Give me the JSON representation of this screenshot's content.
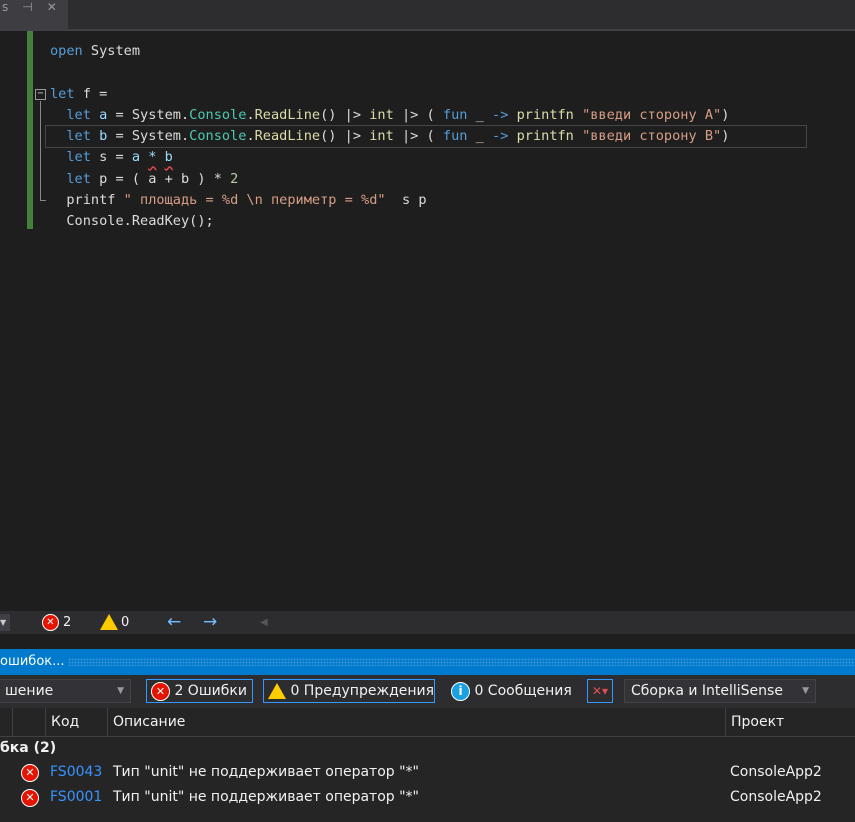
{
  "tab": {
    "label": "s",
    "pin": "⊣",
    "close": "✕"
  },
  "editor": {
    "lines": [
      [
        {
          "t": "open ",
          "c": "kw"
        },
        {
          "t": "System",
          "c": "tx"
        }
      ],
      [],
      [
        {
          "t": "let ",
          "c": "kw"
        },
        {
          "t": "f =",
          "c": "tx"
        }
      ],
      [
        {
          "t": "  let ",
          "c": "kw"
        },
        {
          "t": "a",
          "c": "id"
        },
        {
          "t": " = System.",
          "c": "tx"
        },
        {
          "t": "Console",
          "c": "ty"
        },
        {
          "t": ".",
          "c": "tx"
        },
        {
          "t": "ReadLine",
          "c": "fn"
        },
        {
          "t": "() |> ",
          "c": "tx"
        },
        {
          "t": "int",
          "c": "fn"
        },
        {
          "t": " |> ( ",
          "c": "tx"
        },
        {
          "t": "fun",
          "c": "kw"
        },
        {
          "t": " _ ",
          "c": "tx"
        },
        {
          "t": "->",
          "c": "kw"
        },
        {
          "t": " ",
          "c": "tx"
        },
        {
          "t": "printfn",
          "c": "fn"
        },
        {
          "t": " ",
          "c": "tx"
        },
        {
          "t": "\"введи сторону A\"",
          "c": "st"
        },
        {
          "t": ")",
          "c": "tx"
        }
      ],
      [
        {
          "t": "  let ",
          "c": "kw"
        },
        {
          "t": "b",
          "c": "id"
        },
        {
          "t": " = System.",
          "c": "tx"
        },
        {
          "t": "Console",
          "c": "ty"
        },
        {
          "t": ".",
          "c": "tx"
        },
        {
          "t": "ReadLine",
          "c": "fn"
        },
        {
          "t": "() |> ",
          "c": "tx"
        },
        {
          "t": "int",
          "c": "fn"
        },
        {
          "t": " |> ( ",
          "c": "tx"
        },
        {
          "t": "fun",
          "c": "kw"
        },
        {
          "t": " _ ",
          "c": "tx"
        },
        {
          "t": "->",
          "c": "kw"
        },
        {
          "t": " ",
          "c": "tx"
        },
        {
          "t": "printfn",
          "c": "fn"
        },
        {
          "t": " ",
          "c": "tx"
        },
        {
          "t": "\"введи сторону B\"",
          "c": "st"
        },
        {
          "t": ")",
          "c": "tx"
        }
      ],
      [
        {
          "t": "  let ",
          "c": "kw"
        },
        {
          "t": "s",
          "c": "tx"
        },
        {
          "t": " = ",
          "c": "tx"
        },
        {
          "t": "a",
          "c": "id"
        },
        {
          "t": " ",
          "c": "tx"
        },
        {
          "t": "*",
          "c": "id sq"
        },
        {
          "t": " ",
          "c": "tx"
        },
        {
          "t": "b",
          "c": "id sq"
        }
      ],
      [
        {
          "t": "  let ",
          "c": "kw"
        },
        {
          "t": "p",
          "c": "tx"
        },
        {
          "t": " = ( ",
          "c": "tx"
        },
        {
          "t": "a",
          "c": "tx"
        },
        {
          "t": " + ",
          "c": "tx"
        },
        {
          "t": "b",
          "c": "tx"
        },
        {
          "t": " ) * ",
          "c": "tx"
        },
        {
          "t": "2",
          "c": "nm"
        }
      ],
      [
        {
          "t": "  printf ",
          "c": "tx"
        },
        {
          "t": "\" площадь = %d \\n периметр = %d\"",
          "c": "st"
        },
        {
          "t": "  s p",
          "c": "tx"
        }
      ],
      [
        {
          "t": "  Console.",
          "c": "tx"
        },
        {
          "t": "ReadKey",
          "c": "tx"
        },
        {
          "t": "();",
          "c": "tx"
        }
      ]
    ]
  },
  "status": {
    "errors": "2",
    "warnings": "0",
    "back": "←",
    "forward": "→"
  },
  "error_list": {
    "title": "ошибок...",
    "scope_combo": "шение",
    "errors_btn": "2 Ошибки",
    "warnings_btn": "0 Предупреждения",
    "messages_btn": "0 Сообщения",
    "source_combo": "Сборка и IntelliSense",
    "columns": {
      "code": "Код",
      "description": "Описание",
      "project": "Проект"
    },
    "group": "бка  (2)",
    "rows": [
      {
        "code": "FS0043",
        "description": "Тип \"unit\" не поддерживает оператор \"*\"",
        "project": "ConsoleApp2"
      },
      {
        "code": "FS0001",
        "description": "Тип \"unit\" не поддерживает оператор \"*\"",
        "project": "ConsoleApp2"
      }
    ]
  }
}
